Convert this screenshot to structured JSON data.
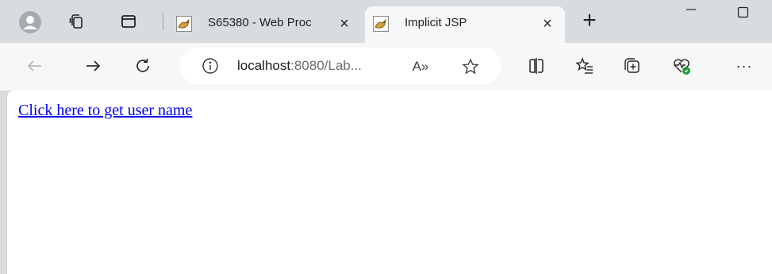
{
  "tabs": [
    {
      "title": "S65380 - Web Proc",
      "close": "×",
      "active": false
    },
    {
      "title": "Implicit JSP",
      "close": "×",
      "active": true
    }
  ],
  "new_tab_label": "+",
  "address_bar": {
    "host": "localhost",
    "rest": ":8080/Lab...",
    "read_aloud_label": "A»"
  },
  "toolbar": {
    "more_label": "···"
  },
  "page": {
    "link_text": "Click here to get user name"
  },
  "colors": {
    "tabstrip": "#d9dcdf",
    "toolbar": "#f7f7f7",
    "link": "#0000ee"
  }
}
